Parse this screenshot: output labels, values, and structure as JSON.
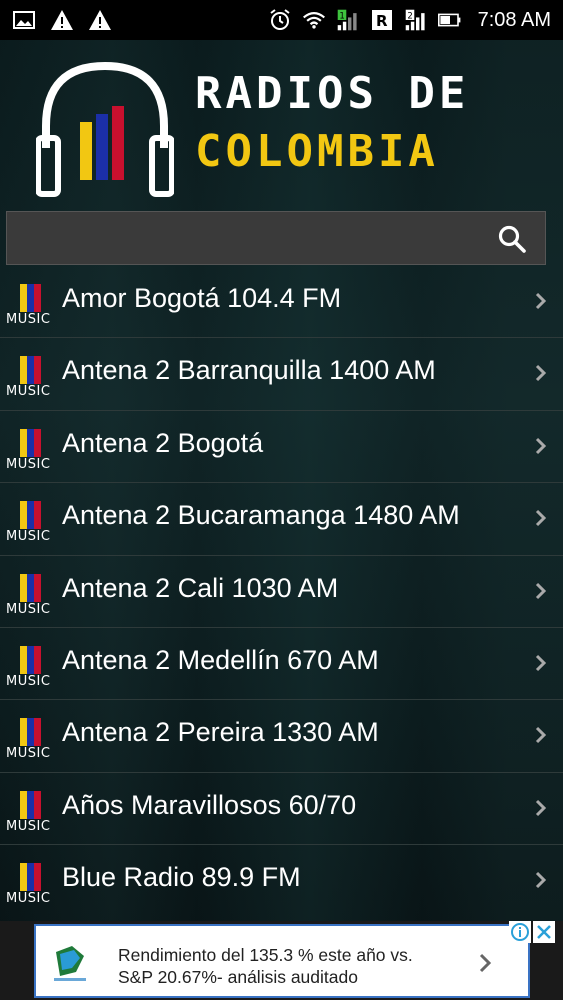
{
  "status_bar": {
    "time": "7:08 AM",
    "icons": [
      "image-icon",
      "alert-icon",
      "alert-icon",
      "alarm-icon",
      "wifi-icon",
      "signal-1-icon",
      "roaming-r-icon",
      "signal-2-icon",
      "battery-icon"
    ]
  },
  "header": {
    "logo_line1": "RADIOS DE",
    "logo_line2": "COLOMBIA"
  },
  "search": {
    "placeholder": "",
    "value": ""
  },
  "stations": [
    {
      "name": "Amor Bogotá 104.4 FM"
    },
    {
      "name": "Antena 2 Barranquilla 1400 AM"
    },
    {
      "name": "Antena 2 Bogotá"
    },
    {
      "name": "Antena 2 Bucaramanga 1480 AM"
    },
    {
      "name": "Antena 2 Cali 1030 AM"
    },
    {
      "name": "Antena 2 Medellín 670 AM"
    },
    {
      "name": "Antena 2 Pereira 1330 AM"
    },
    {
      "name": "Años Maravillosos 60/70"
    },
    {
      "name": "Blue Radio 89.9 FM"
    }
  ],
  "item_logo_caption": "MUSIC",
  "ad": {
    "line1": "Rendimiento del 135.3 % este año vs.",
    "line2": "S&P 20.67%- análisis auditado"
  },
  "colors": {
    "flag_yellow": "#f2c712",
    "flag_blue": "#1b2fa8",
    "flag_red": "#c8102e",
    "accent_yellow": "#f2c712"
  }
}
